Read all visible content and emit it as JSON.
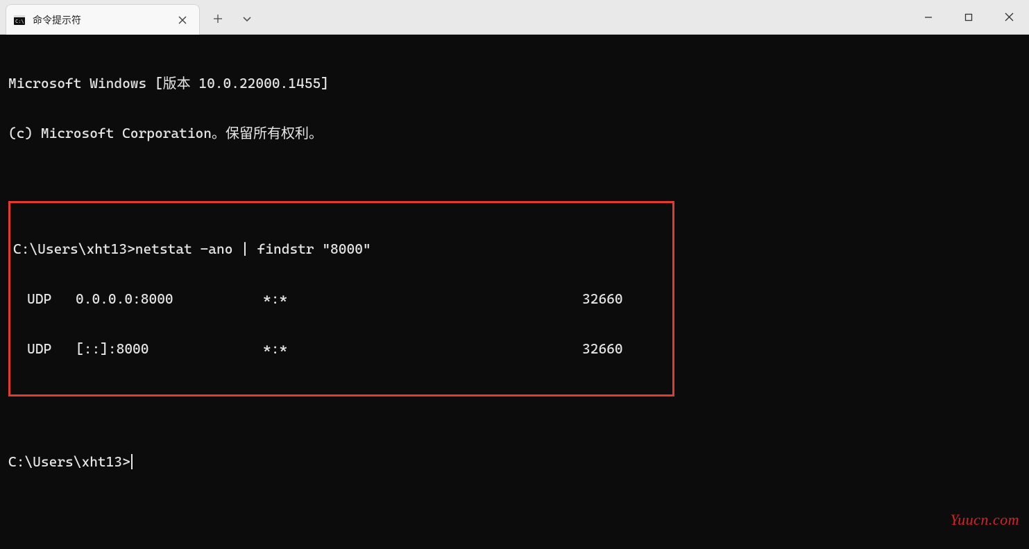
{
  "window": {
    "tab_title": "命令提示符",
    "controls": {
      "minimize": "minimize",
      "maximize": "maximize",
      "close": "close"
    }
  },
  "terminal": {
    "banner_line1": "Microsoft Windows [版本 10.0.22000.1455]",
    "banner_line2": "(c) Microsoft Corporation。保留所有权利。",
    "prompt1": "C:\\Users\\xht13>",
    "command1": "netstat -ano | findstr \"8000\"",
    "rows": [
      {
        "proto": "UDP",
        "local": "0.0.0.0:8000",
        "foreign": "*:*",
        "pid": "32660"
      },
      {
        "proto": "UDP",
        "local": "[::]:8000",
        "foreign": "*:*",
        "pid": "32660"
      }
    ],
    "prompt2": "C:\\Users\\xht13>"
  },
  "watermark": "Yuucn.com"
}
